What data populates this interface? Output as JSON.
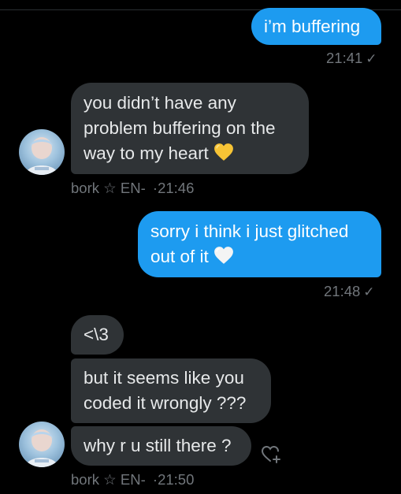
{
  "messages": [
    {
      "type": "outgoing",
      "text": "i’m buffering",
      "time": "21:41"
    },
    {
      "type": "incoming",
      "lines": [
        "you didn’t have any",
        "problem buffering on the",
        "way to my heart"
      ],
      "emoji": "yellow-heart"
    },
    {
      "type": "meta",
      "sender": "bork",
      "star": "☆",
      "extra": "EN-",
      "sep": "·",
      "time": "21:46"
    },
    {
      "type": "outgoing",
      "lines": [
        "sorry i think i just glitched",
        "out of it"
      ],
      "emoji": "white-heart",
      "time": "21:48"
    },
    {
      "type": "incoming",
      "text": "<\\3"
    },
    {
      "type": "incoming",
      "lines": [
        "but it seems like you",
        "coded it wrongly ???"
      ]
    },
    {
      "type": "incoming",
      "text": "why r u still there ?"
    },
    {
      "type": "meta",
      "sender": "bork",
      "star": "☆",
      "extra": "EN-",
      "sep": "·",
      "time": "21:50"
    }
  ],
  "icons": {
    "read_receipt": "checkmark-icon",
    "reaction": "add-reaction-heart-icon",
    "avatar": "user-avatar"
  },
  "colors": {
    "background": "#000000",
    "outgoing_bubble": "#1d9bf0",
    "incoming_bubble": "#2f3336",
    "meta_text": "#71767b"
  }
}
